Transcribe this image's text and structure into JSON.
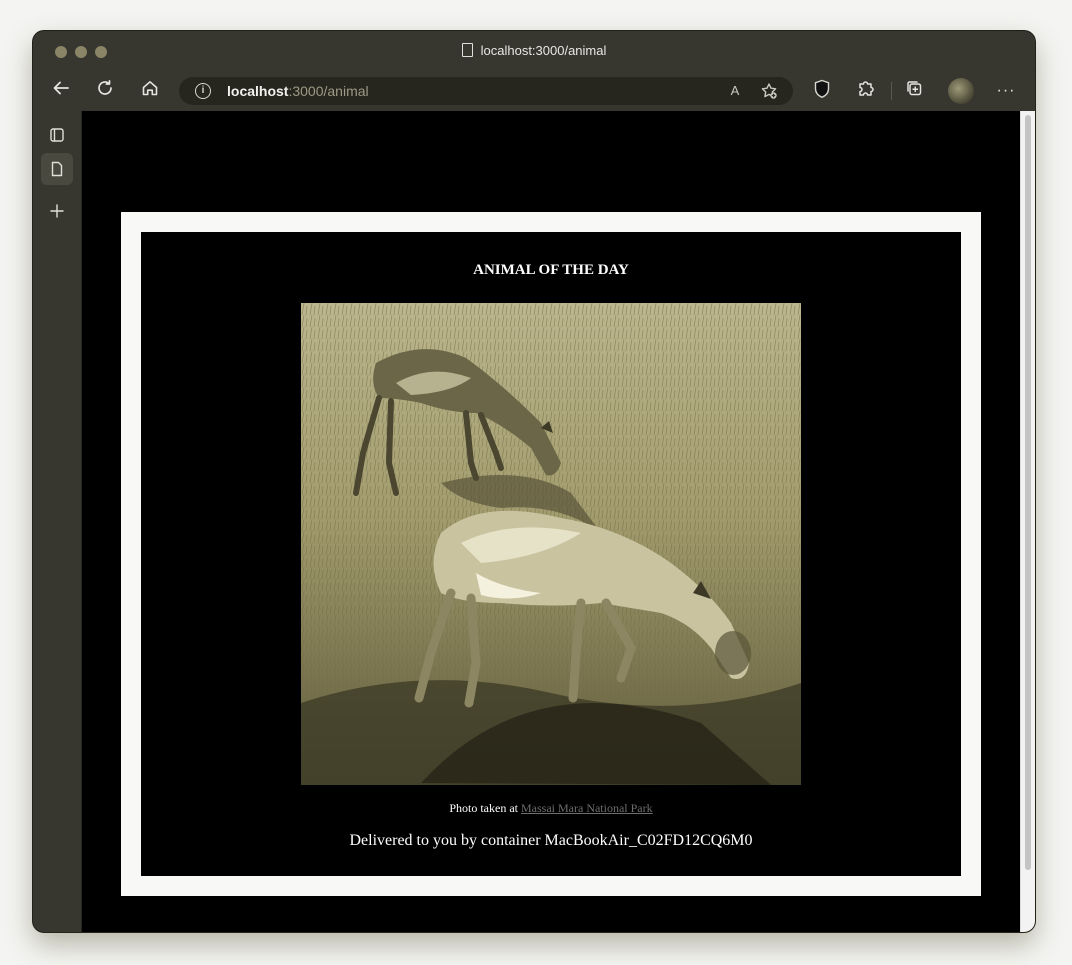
{
  "browser": {
    "tab_title": "localhost:3000/animal",
    "url_host": "localhost",
    "url_path": ":3000/animal",
    "icons": {
      "back": "back-arrow-icon",
      "reload": "reload-icon",
      "home": "home-icon",
      "info": "info-icon",
      "read_aloud": "read-aloud-icon",
      "favorite": "add-favorite-icon",
      "extension_shield": "ublock-shield-icon",
      "extensions": "puzzle-icon",
      "collections": "collections-icon",
      "profile": "profile-avatar",
      "more": "more-icon"
    },
    "info_glyph": "i",
    "read_aloud_glyph": "A",
    "shield_glyph": "uO",
    "more_glyph": "···"
  },
  "page": {
    "title": "ANIMAL OF THE DAY",
    "photo_alt": "two impalas grazing in grass",
    "caption_prefix": "Photo taken at",
    "caption_link": "Massai Mara National Park",
    "delivered": "Delivered to you by container MacBookAir_C02FD12CQ6M0"
  },
  "colors": {
    "page_background": "#000000",
    "frame_border": "#f8f8f6",
    "link": "#6e6e6e",
    "photo_tint": "#a8a276"
  }
}
